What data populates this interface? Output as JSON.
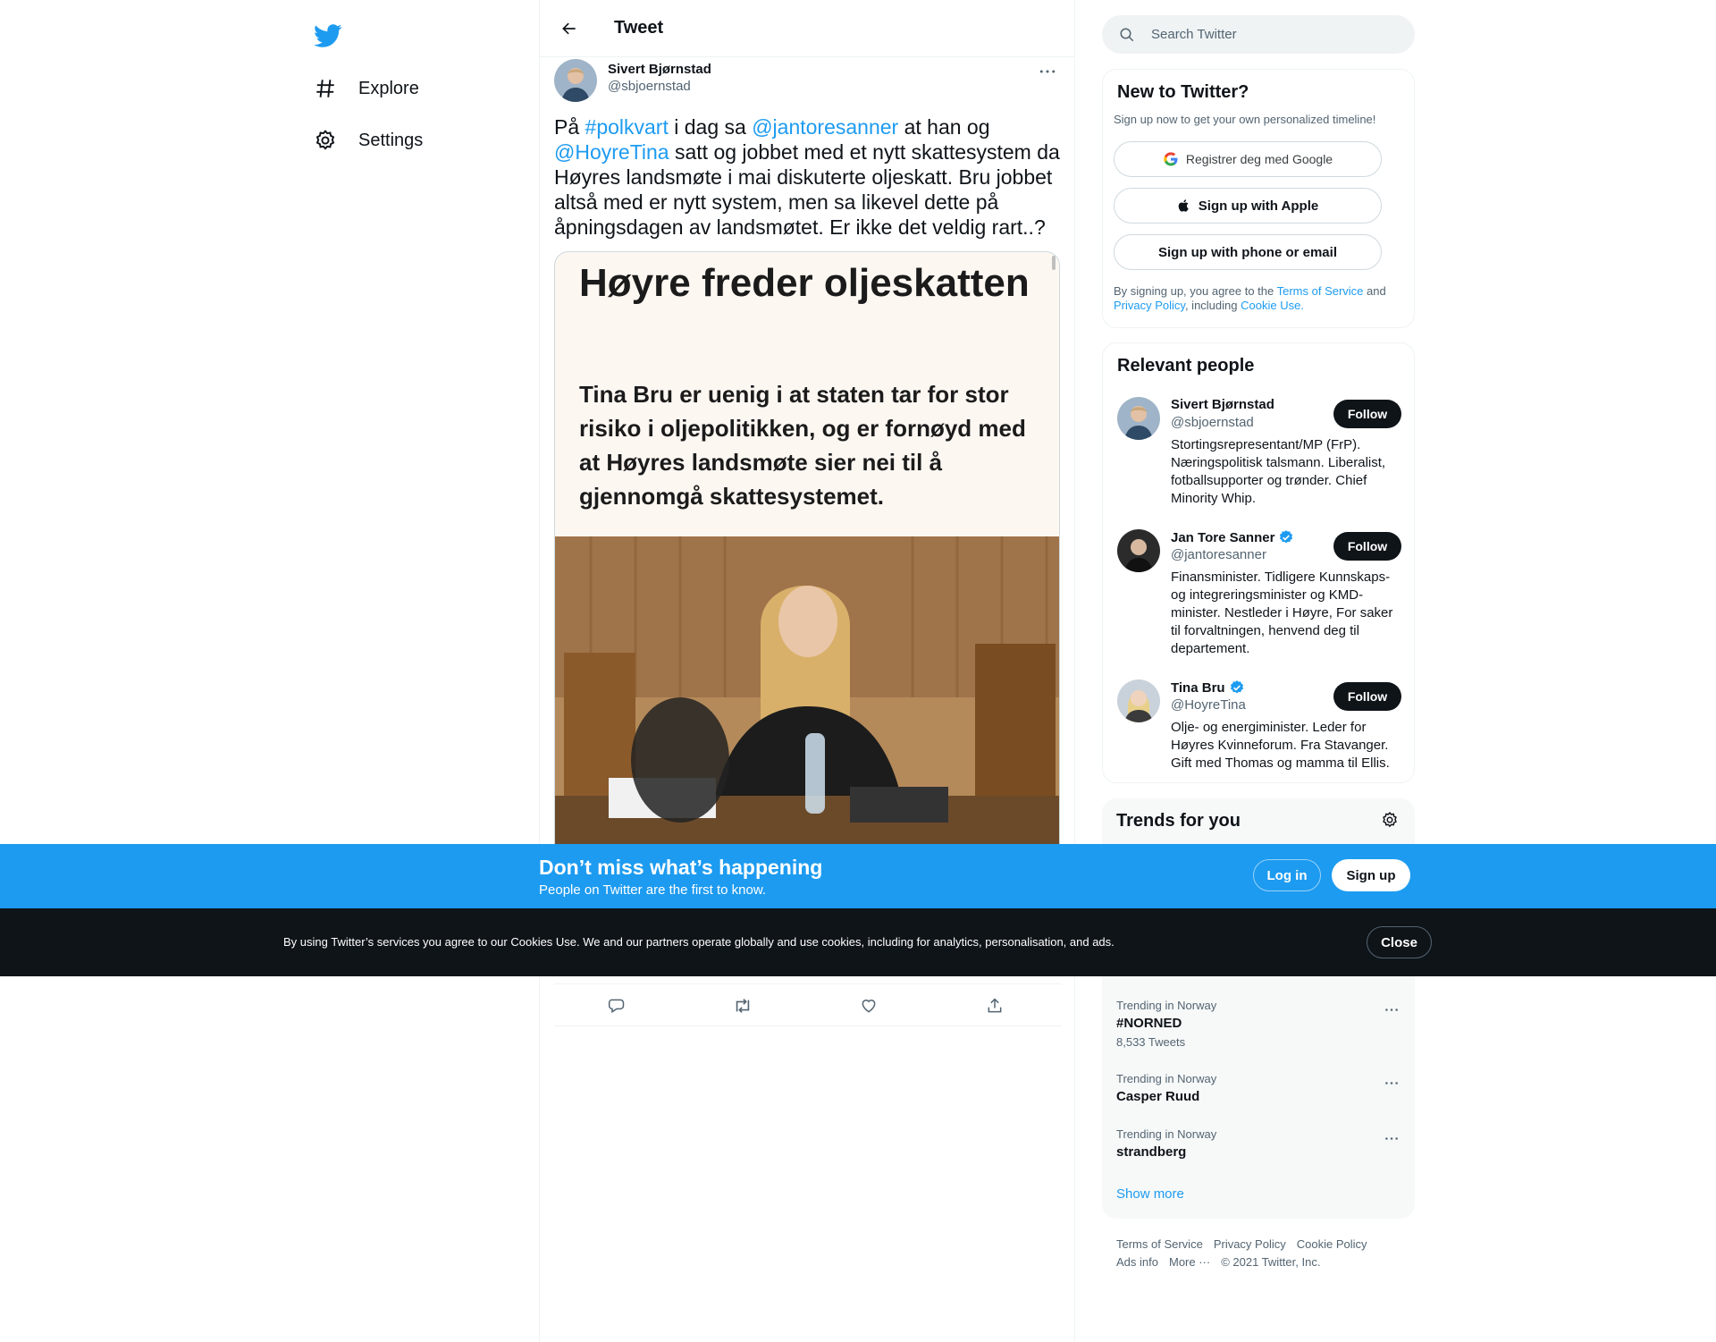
{
  "nav": {
    "logo_icon": "twitter-bird-icon",
    "items": [
      {
        "label": "Explore",
        "icon": "hashtag-icon"
      },
      {
        "label": "Settings",
        "icon": "gear-icon"
      }
    ]
  },
  "header": {
    "title": "Tweet",
    "back_icon": "arrow-left-icon"
  },
  "tweet": {
    "author_name": "Sivert Bjørnstad",
    "author_handle": "@sbjoernstad",
    "text_parts": {
      "p1": "På ",
      "hashtag": "#polkvart",
      "p2": " i dag sa ",
      "mention1": "@jantoresanner",
      "p3": " at han og ",
      "mention2": "@HoyreTina",
      "p4": " satt og jobbet med et nytt skattesystem da Høyres landsmøte i mai diskuterte oljeskatt. Bru jobbet altså med er nytt system, men sa likevel dette på åpningsdagen av landsmøtet. Er ikke det veldig rart..?"
    },
    "media": {
      "headline": "Høyre freder oljeskatten",
      "subheadline": "Tina Bru er uenig i at staten tar for stor risiko i oljepolitikken, og er fornøyd med at Høyres landsmøte sier nei til å gjennomgå skattesystemet."
    },
    "actions": [
      "reply-icon",
      "retweet-icon",
      "like-icon",
      "share-icon"
    ]
  },
  "search": {
    "placeholder": "Search Twitter"
  },
  "signup": {
    "title": "New to Twitter?",
    "subtitle": "Sign up now to get your own personalized timeline!",
    "google": "Registrer deg med Google",
    "apple": "Sign up with Apple",
    "phone": "Sign up with phone or email",
    "legal": {
      "prefix": "By signing up, you agree to the ",
      "terms": "Terms of Service",
      "and": " and ",
      "privacy": "Privacy Policy",
      "including": ", including ",
      "cookie": "Cookie Use."
    }
  },
  "people": {
    "title": "Relevant people",
    "follow_label": "Follow",
    "list": [
      {
        "name": "Sivert Bjørnstad",
        "handle": "@sbjoernstad",
        "verified": false,
        "bio": "Stortingsrepresentant/MP (FrP). Næringspolitisk talsmann. Liberalist, fotballsupporter og trønder. Chief Minority Whip."
      },
      {
        "name": "Jan Tore Sanner",
        "handle": "@jantoresanner",
        "verified": true,
        "bio": "Finansminister. Tidligere Kunnskaps- og integreringsminister og KMD-minister. Nestleder i Høyre, For saker til forvaltningen, henvend deg til departement."
      },
      {
        "name": "Tina Bru",
        "handle": "@HoyreTina",
        "verified": true,
        "bio": "Olje- og energiminister. Leder for Høyres Kvinneforum. Fra Stavanger. Gift med Thomas og mamma til Ellis."
      }
    ]
  },
  "trends": {
    "title": "Trends for you",
    "items": [
      {
        "context": "Trending in Norway",
        "name": "#NORNED",
        "count": "8,533 Tweets"
      },
      {
        "context": "Trending in Norway",
        "name": "Casper Ruud",
        "count": ""
      },
      {
        "context": "Trending in Norway",
        "name": "strandberg",
        "count": ""
      }
    ],
    "show_more": "Show more"
  },
  "footer": {
    "links": [
      "Terms of Service",
      "Privacy Policy",
      "Cookie Policy",
      "Ads info",
      "More ···"
    ],
    "copyright": "© 2021 Twitter, Inc."
  },
  "banner": {
    "title": "Don’t miss what’s happening",
    "subtitle": "People on Twitter are the first to know.",
    "login": "Log in",
    "signup": "Sign up"
  },
  "cookie": {
    "text": "By using Twitter’s services you agree to our Cookies Use. We and our partners operate globally and use cookies, including for analytics, personalisation, and ads.",
    "close": "Close"
  },
  "colors": {
    "accent": "#1d9bf0",
    "text": "#0f1419",
    "muted": "#536471",
    "dark_bar": "#0f1419"
  }
}
